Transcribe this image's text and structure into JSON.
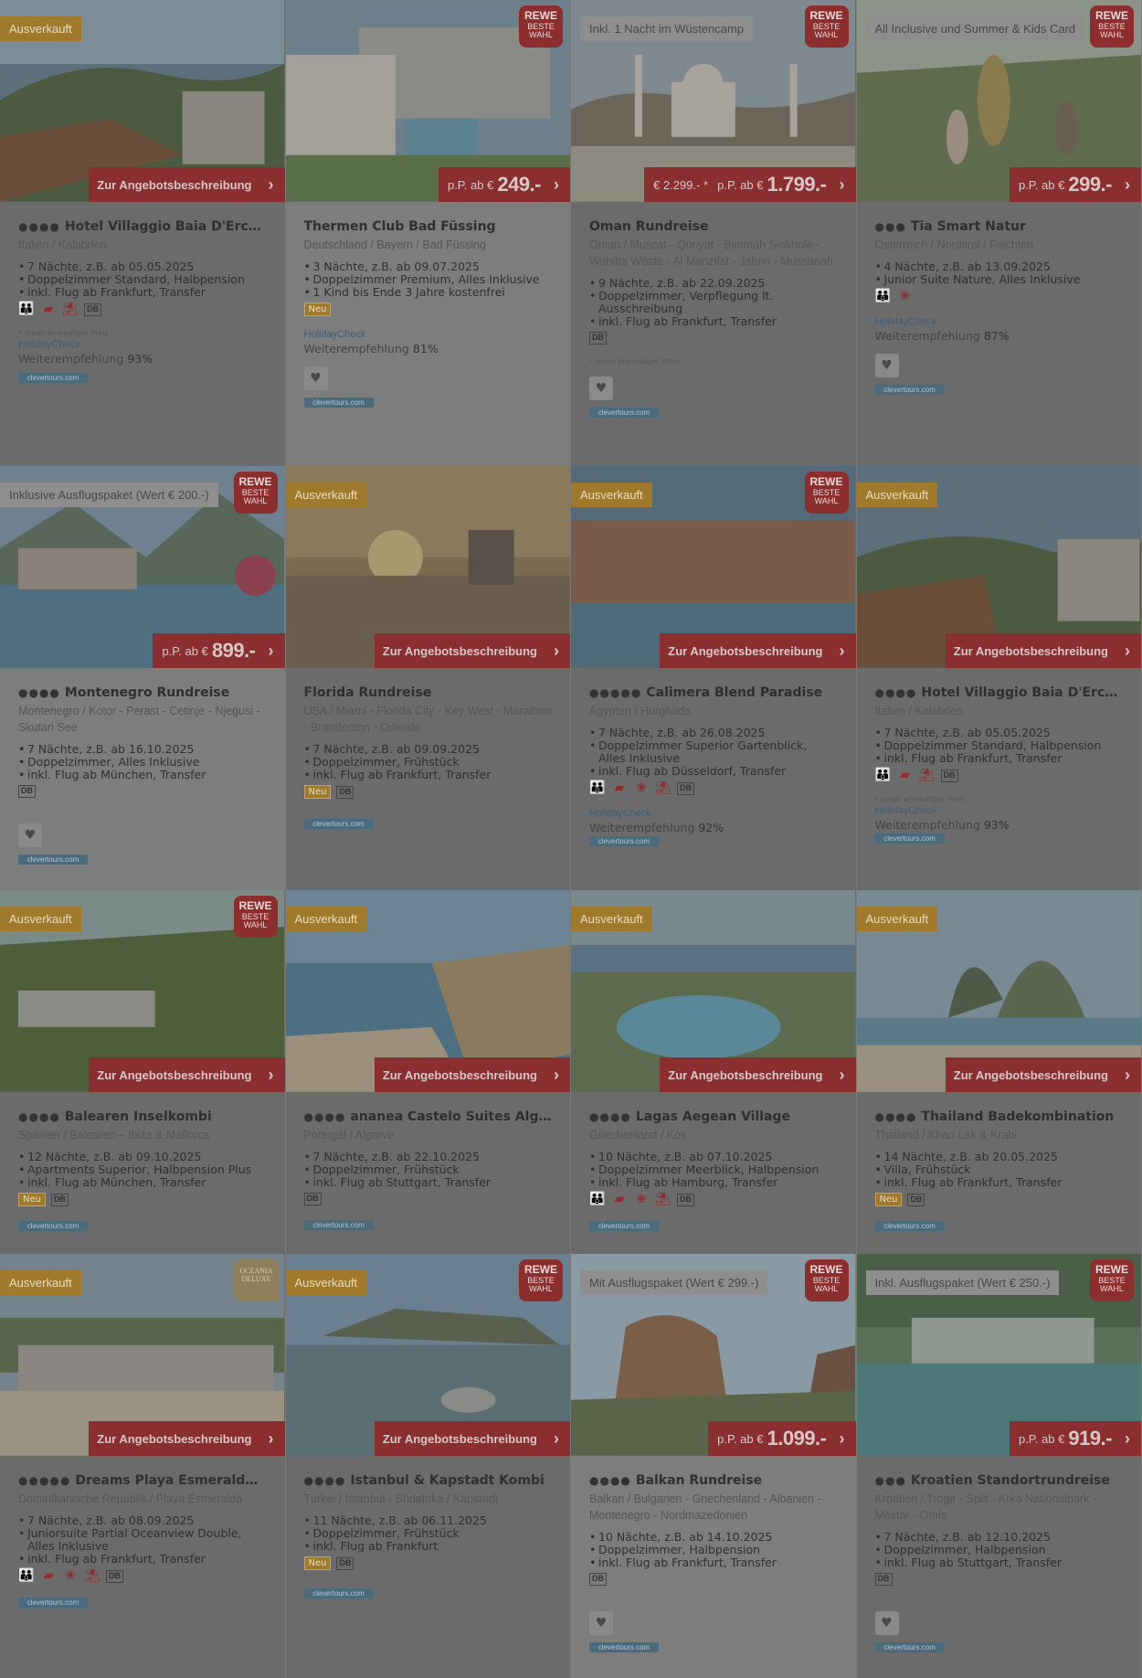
{
  "labels": {
    "sold_out": "Ausverkauft",
    "cta": "Zur Angebotsbeschreibung",
    "pp": "p.P. ab €",
    "rewe_top": "REWE",
    "rewe_bottom": "BESTE WAHL",
    "neu": "Neu",
    "db": "DB",
    "holidaycheck": "HolidayCheck",
    "recommend_prefix": "Weiterempfehlung",
    "former_price_note": "* unser ehemaliger Preis",
    "clevertours": "clevertours.com",
    "oceania": "OCEANIA DELUXE"
  },
  "offers": [
    {
      "title": "Hotel Villaggio Baia D'Ercole",
      "stars": "●●●●",
      "location": "Italien / Kalabrien",
      "facts": [
        "7 Nächte, z.B. ab 05.05.2025",
        "Doppelzimmer Standard, Halbpension",
        "inkl. Flug ab Frankfurt, Transfer"
      ],
      "badge": "Ausverkauft",
      "recommend": "93%"
    },
    {
      "title": "Thermen Club Bad Füssing",
      "stars": "",
      "location": "Deutschland / Bayern / Bad Füssing",
      "facts": [
        "3 Nächte, z.B. ab 09.07.2025",
        "Doppelzimmer Premium, Alles Inklusive",
        "1 Kind bis Ende 3 Jahre kostenfrei"
      ],
      "price": "249.-",
      "recommend": "81%"
    },
    {
      "title": "Oman Rundreise",
      "stars": "",
      "location": "Oman / Muscat - Quriyat - Bimmah Sinkhole - Wahiba Wüste - Al Manzifat - Jabrin - Mussanah",
      "facts": [
        "9 Nächte, z.B. ab 22.09.2025",
        "Doppelzimmer, Verpflegung lt. Ausschreibung",
        "inkl. Flug ab Frankfurt, Transfer"
      ],
      "promo": "Inkl. 1 Nacht im Wüstencamp",
      "price": "1.799.-",
      "old_price": "€ 2.299.- *"
    },
    {
      "title": "Tia Smart Natur",
      "stars": "●●●",
      "location": "Österreich / Nordtirol / Feichten",
      "facts": [
        "4 Nächte, z.B. ab 13.09.2025",
        "Junior Suite Nature, Alles Inklusive"
      ],
      "promo": "All Inclusive und Summer & Kids Card",
      "price": "299.-",
      "recommend": "87%"
    },
    {
      "title": "Montenegro Rundreise",
      "stars": "●●●●",
      "location": "Montenegro / Kotor - Perast - Cetinje - Njegusi - Skutari See",
      "facts": [
        "7 Nächte, z.B. ab 16.10.2025",
        "Doppelzimmer, Alles Inklusive",
        "inkl. Flug ab München, Transfer"
      ],
      "promo": "Inklusive Ausflugspaket (Wert € 200.-)",
      "price": "899.-"
    },
    {
      "title": "Florida Rundreise",
      "stars": "",
      "location": "USA / Miami - Florida City - Key West - Marathon - Brandenton - Orlando",
      "facts": [
        "7 Nächte, z.B. ab 09.09.2025",
        "Doppelzimmer, Frühstück",
        "inkl. Flug ab Frankfurt, Transfer"
      ],
      "badge": "Ausverkauft"
    },
    {
      "title": "Calimera Blend Paradise",
      "stars": "●●●●●",
      "location": "Ägypten / Hurghada",
      "facts": [
        "7 Nächte, z.B. ab 26.08.2025",
        "Doppelzimmer Superior Gartenblick, Alles Inklusive",
        "inkl. Flug ab Düsseldorf, Transfer"
      ],
      "badge": "Ausverkauft",
      "recommend": "92%"
    },
    {
      "title": "Hotel Villaggio Baia D'Ercole",
      "stars": "●●●●",
      "location": "Italien / Kalabrien",
      "facts": [
        "7 Nächte, z.B. ab 05.05.2025",
        "Doppelzimmer Standard, Halbpension",
        "inkl. Flug ab Frankfurt, Transfer"
      ],
      "badge": "Ausverkauft",
      "recommend": "93%"
    },
    {
      "title": "Balearen Inselkombi",
      "stars": "●●●●",
      "location": "Spanien / Balearen – Ibiza & Mallorca",
      "facts": [
        "12 Nächte, z.B. ab 09.10.2025",
        "Apartments Superior, Halbpension Plus",
        "inkl. Flug ab München, Transfer"
      ],
      "badge": "Ausverkauft"
    },
    {
      "title": "ananea Castelo Suites Algarve",
      "stars": "●●●●",
      "location": "Portugal / Algarve",
      "facts": [
        "7 Nächte, z.B. ab 22.10.2025",
        "Doppelzimmer, Frühstück",
        "inkl. Flug ab Stuttgart, Transfer"
      ],
      "badge": "Ausverkauft"
    },
    {
      "title": "Lagas Aegean Village",
      "stars": "●●●●",
      "location": "Griechenland / Kos",
      "facts": [
        "10 Nächte, z.B. ab 07.10.2025",
        "Doppelzimmer Meerblick, Halbpension",
        "inkl. Flug ab Hamburg, Transfer"
      ],
      "badge": "Ausverkauft"
    },
    {
      "title": "Thailand Badekombination",
      "stars": "●●●●",
      "location": "Thailand / Khao Lak & Krabi",
      "facts": [
        "14 Nächte, z.B. ab 20.05.2025",
        "Villa, Frühstück",
        "inkl. Flug ab Frankfurt, Transfer"
      ],
      "badge": "Ausverkauft"
    },
    {
      "title": "Dreams Playa Esmeralda Re...",
      "stars": "●●●●●",
      "location": "Dominikanische Republik / Playa Esmeralda",
      "facts": [
        "7 Nächte, z.B. ab 08.09.2025",
        "Juniorsuite Partial Oceanview Double, Alles Inklusive",
        "inkl. Flug ab Frankfurt, Transfer"
      ],
      "badge": "Ausverkauft"
    },
    {
      "title": "Istanbul & Kapstadt Kombi",
      "stars": "●●●●",
      "location": "Türkei / Istanbul - Südafrika / Kapstadt",
      "facts": [
        "11 Nächte, z.B. ab 06.11.2025",
        "Doppelzimmer, Frühstück",
        "inkl. Flug ab Frankfurt"
      ],
      "badge": "Ausverkauft"
    },
    {
      "title": "Balkan Rundreise",
      "stars": "●●●●",
      "location": "Balkan / Bulgarien - Griechenland - Albanien - Montenegro - Nordmazedonien",
      "facts": [
        "10 Nächte, z.B. ab 14.10.2025",
        "Doppelzimmer, Halbpension",
        "inkl. Flug ab Frankfurt, Transfer"
      ],
      "promo": "Mit Ausflugspaket (Wert € 299.-)",
      "price": "1.099.-"
    },
    {
      "title": "Kroatien Standortrundreise",
      "stars": "●●●",
      "location": "Kroatien / Trogir - Split - Krka Nationalpark - Mostar - Omis",
      "facts": [
        "7 Nächte, z.B. ab 12.10.2025",
        "Doppelzimmer, Halbpension",
        "inkl. Flug ab Stuttgart, Transfer"
      ],
      "promo": "Inkl. Ausflugspaket (Wert € 250.-)",
      "price": "919.-"
    }
  ]
}
